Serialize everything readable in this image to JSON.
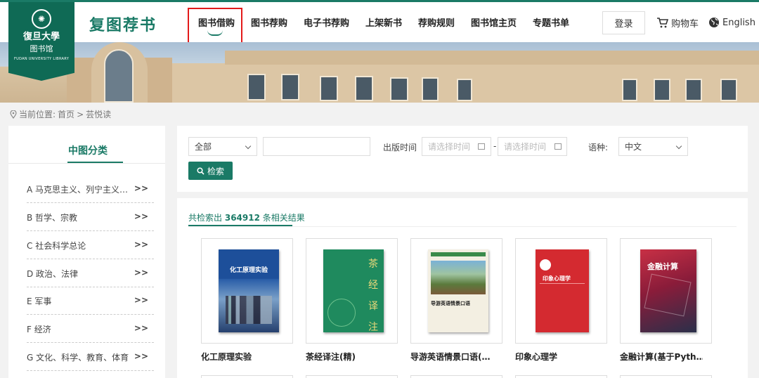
{
  "header": {
    "logo": {
      "univ": "復旦大學",
      "lib": "图书馆",
      "eng": "FUDAN UNIVERSITY LIBRARY"
    },
    "brand": "复图荐书",
    "nav": [
      "图书借购",
      "图书荐购",
      "电子书荐购",
      "上架新书",
      "荐购规则",
      "图书馆主页",
      "专题书单"
    ],
    "active_nav": "图书借购",
    "login": "登录",
    "cart": "购物车",
    "language": "English"
  },
  "breadcrumb": {
    "prefix": "当前位置:",
    "home": "首页",
    "sep": ">",
    "current": "芸悦读"
  },
  "sidebar": {
    "title": "中图分类",
    "arrow": ">>",
    "categories": [
      "A 马克思主义、列宁主义、毛泽东思想、邓小平理论",
      "B 哲学、宗教",
      "C 社会科学总论",
      "D 政治、法律",
      "E 军事",
      "F 经济",
      "G 文化、科学、教育、体育"
    ]
  },
  "search": {
    "scope_value": "全部",
    "keyword_value": "",
    "pub_time_label": "出版时间",
    "date_start_placeholder": "请选择时间",
    "date_sep": "-",
    "date_end_placeholder": "请选择时间",
    "lang_label": "语种:",
    "lang_value": "中文",
    "button": "检索"
  },
  "results": {
    "prefix": "共检索出",
    "count": "364912",
    "suffix": "条相关结果",
    "books": [
      {
        "title": "化工原理实验",
        "cover_text": "化工原理实验",
        "color": "#1d4f9a"
      },
      {
        "title": "茶经译注(精)",
        "cover_text": "茶经译注",
        "color": "#1f8a5e"
      },
      {
        "title": "导游英语情景口语(…",
        "cover_text": "导游英语情景口语",
        "color": "#f3efe2"
      },
      {
        "title": "印象心理学",
        "cover_text": "印象心理学",
        "color": "#d42a30"
      },
      {
        "title": "金融计算(基于Pyth…",
        "cover_text": "金融计算",
        "color": "#b8263a"
      }
    ]
  },
  "colors": {
    "primary": "#1a7a66",
    "highlight": "#e31a1a"
  }
}
